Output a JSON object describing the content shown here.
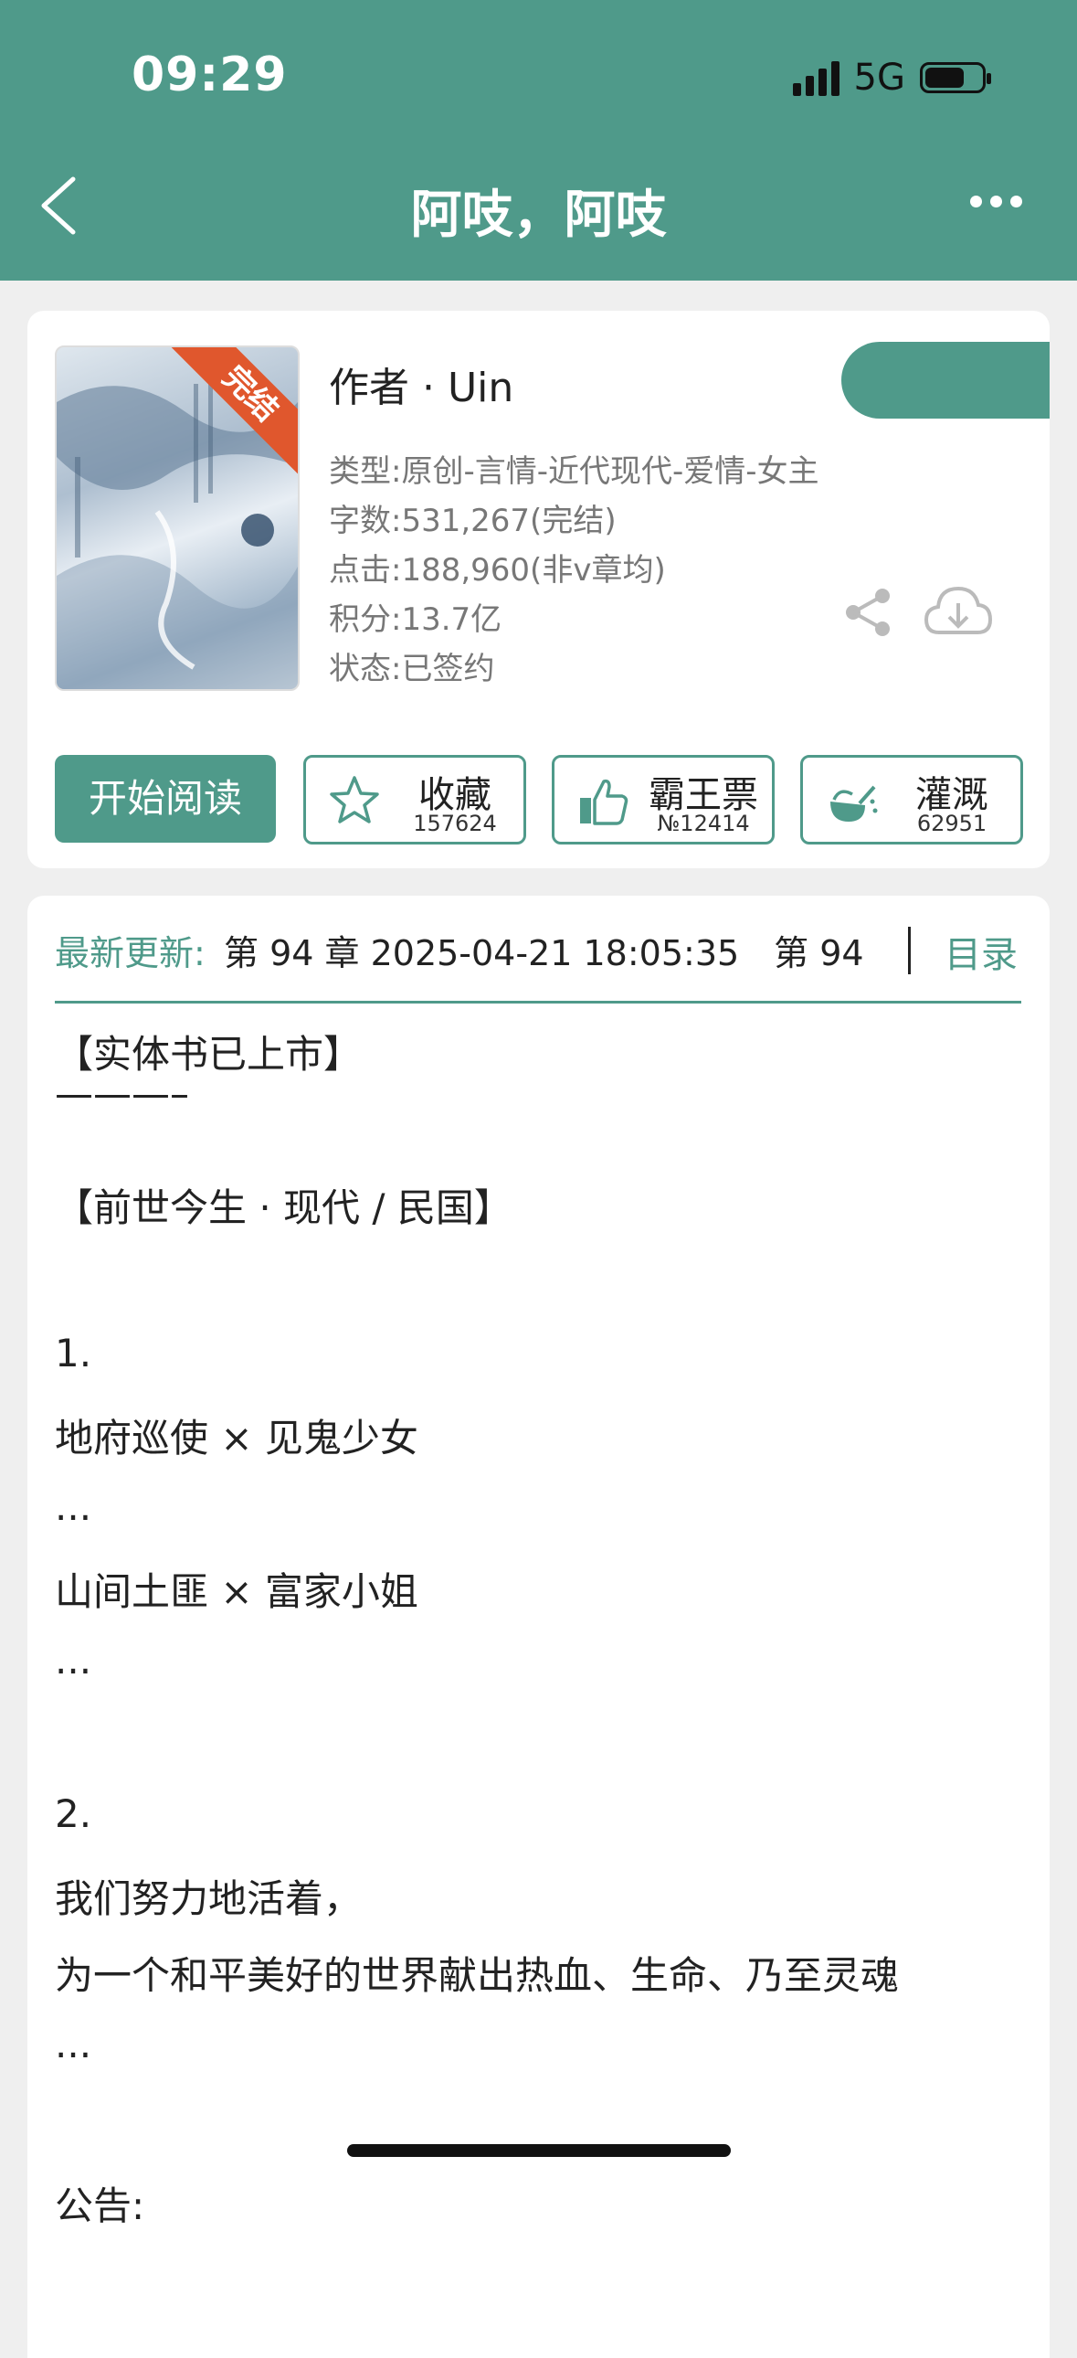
{
  "status_bar": {
    "time": "09:29",
    "network": "5G"
  },
  "header": {
    "title": "阿吱，阿吱"
  },
  "book": {
    "cover_badge": "完结",
    "author": "作者 · Uin",
    "genre": "类型:原创-言情-近代现代-爱情-女主",
    "word_count": "字数:531,267(完结)",
    "clicks": "点击:188,960(非v章均)",
    "score": "积分:13.7亿",
    "status": "状态:已签约"
  },
  "actions": {
    "read_label": "开始阅读",
    "collect": {
      "label": "收藏",
      "count": "157624"
    },
    "vote": {
      "label": "霸王票",
      "count": "№12414"
    },
    "water": {
      "label": "灌溉",
      "count": "62951"
    }
  },
  "update": {
    "label": "最新更新:",
    "text": "第 94 章 2025-04-21 18:05:35　第 94",
    "toc_label": "目录"
  },
  "intro_lines": [
    "【实体书已上市】",
    "———–",
    "【前世今生 · 现代 / 民国】",
    "1.",
    "地府巡使 × 见鬼少女",
    "...",
    "山间土匪 × 富家小姐",
    "...",
    "2.",
    "我们努力地活着，",
    "为一个和平美好的世界献出热血、生命、乃至灵魂",
    "...",
    "公告:"
  ],
  "colors": {
    "accent": "#4f9a8a",
    "badge": "#e0572d"
  },
  "icons": [
    "back-icon",
    "more-icon",
    "share-icon",
    "download-icon",
    "star-icon",
    "thumbs-up-icon",
    "watering-icon"
  ]
}
